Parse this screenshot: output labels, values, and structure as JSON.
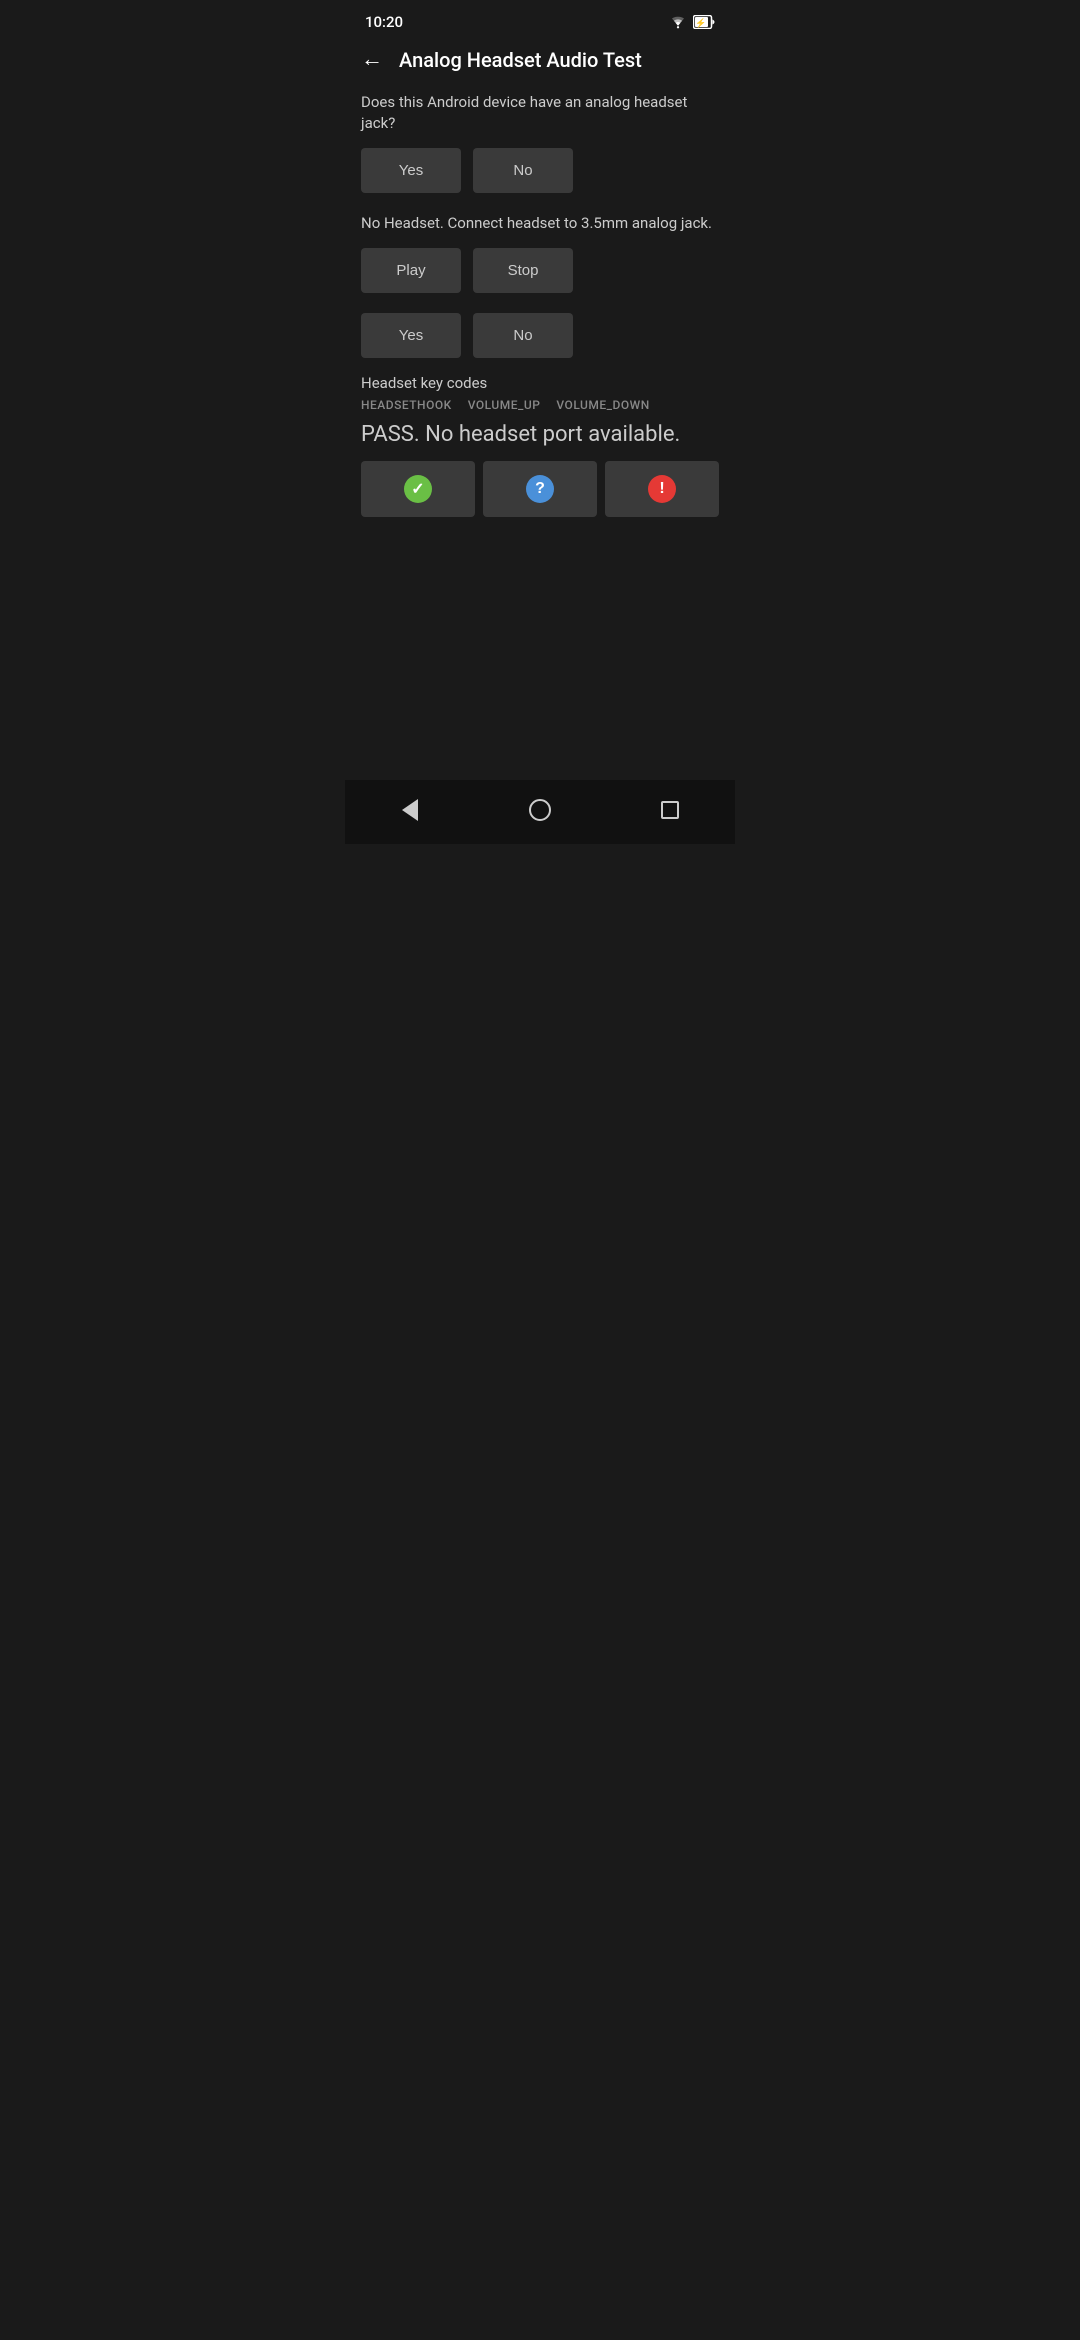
{
  "statusBar": {
    "time": "10:20"
  },
  "toolbar": {
    "backLabel": "←",
    "title": "Analog Headset Audio Test"
  },
  "section1": {
    "question": "Does this Android device have an analog headset jack?",
    "yesLabel": "Yes",
    "noLabel": "No"
  },
  "section2": {
    "infoText": "No Headset. Connect headset to 3.5mm analog jack.",
    "playLabel": "Play",
    "stopLabel": "Stop"
  },
  "section3": {
    "yesLabel": "Yes",
    "noLabel": "No"
  },
  "section4": {
    "title": "Headset key codes",
    "keyCodes": [
      "HEADSETHOOK",
      "VOLUME_UP",
      "VOLUME_DOWN"
    ],
    "passText": "PASS. No headset port available."
  },
  "resultButtons": {
    "passIcon": "✓",
    "infoIcon": "?",
    "failIcon": "!"
  },
  "navBar": {
    "backTitle": "back",
    "homeTitle": "home",
    "recentTitle": "recent"
  }
}
